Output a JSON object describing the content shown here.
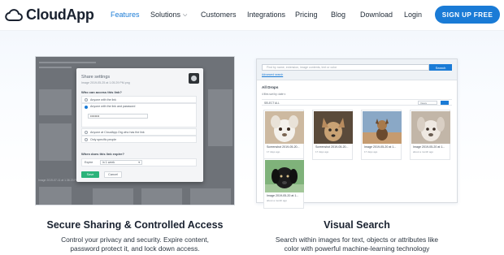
{
  "header": {
    "logo_text": "CloudApp",
    "nav": [
      {
        "label": "Features",
        "active": true
      },
      {
        "label": "Solutions",
        "dropdown": true
      },
      {
        "label": "Customers"
      },
      {
        "label": "Integrations"
      },
      {
        "label": "Pricing"
      },
      {
        "label": "Blog"
      },
      {
        "label": "Download"
      },
      {
        "label": "Login"
      }
    ],
    "cta_label": "SIGN UP FREE",
    "accent_color": "#1a7bd6"
  },
  "left_feature": {
    "title": "Secure Sharing & Controlled Access",
    "description_line1": "Control your privacy and security. Expire content,",
    "description_line2": "password protect it, and lock down access.",
    "dialog": {
      "title": "Share settings",
      "subtitle": "Image 2019-05-25 at 1.05.29 PM.png",
      "question_access": "Who can access this link?",
      "options": [
        {
          "label": "Anyone with the link",
          "selected": false
        },
        {
          "label": "Anyone with the link and password",
          "selected": true
        },
        {
          "label": "Anyone at CloudApp.Org who has the link",
          "selected": false
        },
        {
          "label": "Only specific people",
          "selected": false
        }
      ],
      "password_value": "••••••••",
      "question_expiry": "When does this link expire?",
      "expiry_label": "Expire",
      "expiry_value": "in 1 week",
      "save_label": "Save",
      "cancel_label": "Cancel"
    },
    "background_caption": "Image 2019-07-11 at 1.36.23 PM"
  },
  "right_feature": {
    "title": "Visual Search",
    "description_line1": "Search within images for text, objects or attributes like",
    "description_line2": "color with powerful machine-learning technology",
    "app": {
      "search_placeholder": "Find by name, extension, image contents, text or color",
      "search_button": "Search",
      "advanced_link": "Advanced search",
      "section_title": "All Drops",
      "files_sort": "4 files sort by: date ▾",
      "select_all": "SELECT ALL",
      "view_select": "Views",
      "thumbnails": [
        {
          "caption": "Screenshot 2019-05-20...",
          "meta": "17 days ago",
          "colors": [
            "#cdb9a0",
            "#f4f1ec",
            "#7a6552"
          ]
        },
        {
          "caption": "Screenshot 2019-05-20...",
          "meta": "17 days ago",
          "colors": [
            "#5a4a3a",
            "#c9a274",
            "#2f2a26"
          ]
        },
        {
          "caption": "Image 2019-05-20 at 1...",
          "meta": "17 days ago",
          "colors": [
            "#c59b70",
            "#8aa8c6",
            "#6b4a2e"
          ]
        },
        {
          "caption": "Image 2019-05-20 at 1...",
          "meta": "about a month ago",
          "colors": [
            "#c2b6a8",
            "#efe9e2",
            "#6a5d52"
          ]
        },
        {
          "caption": "Image 2019-05-20 at 1...",
          "meta": "about a month ago",
          "colors": [
            "#7fb27a",
            "#1c1c1c",
            "#a3c79a"
          ]
        }
      ]
    }
  }
}
